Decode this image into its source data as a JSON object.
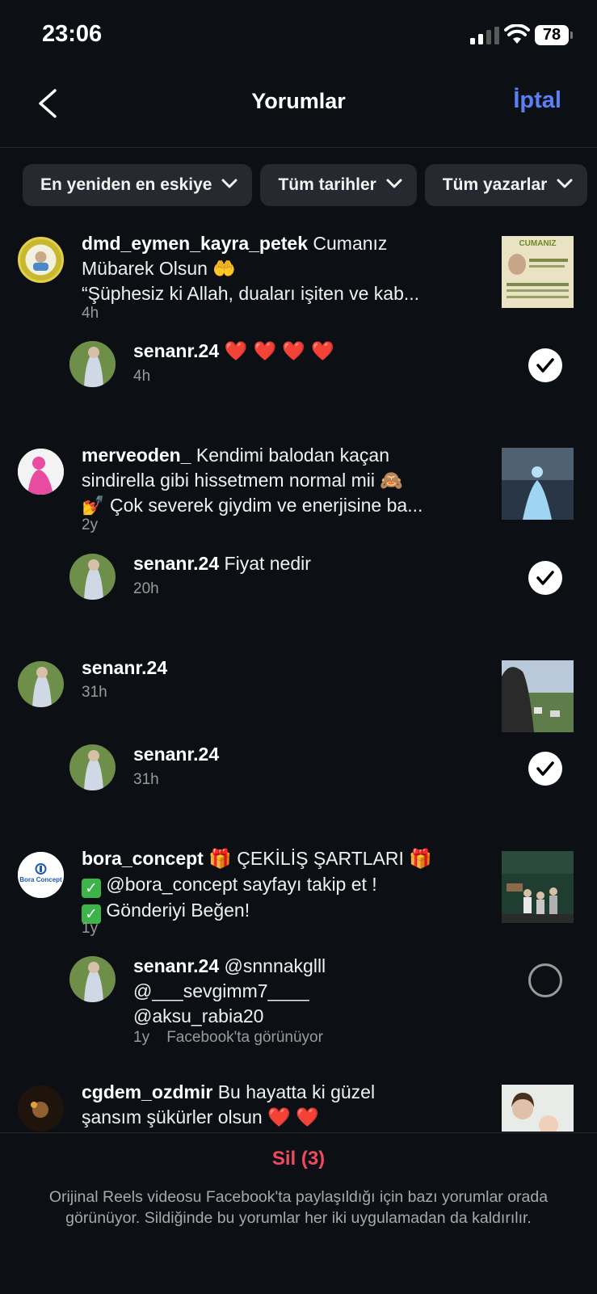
{
  "status": {
    "time": "23:06",
    "battery": "78"
  },
  "header": {
    "title": "Yorumlar",
    "cancel_label": "İptal"
  },
  "filters": [
    "En yeniden en eskiye",
    "Tüm tarihler",
    "Tüm yazarlar"
  ],
  "comments": [
    {
      "post": {
        "username": "dmd_eymen_kayra_petek",
        "text_line1": " Cumanız",
        "text_line2": "Mübarek Olsun 🤲",
        "text_line3": "“Şüphesiz ki Allah, duaları işiten ve kab...",
        "time": "4h",
        "thumb_text": "CUMANIZ"
      },
      "reply": {
        "username": "senanr.24",
        "text": "❤️ ❤️ ❤️ ❤️",
        "time": "4h",
        "selected": true
      }
    },
    {
      "post": {
        "username": "merveoden_",
        "text_line1": " Kendimi balodan kaçan",
        "text_line2": "sindirella gibi hissetmem normal mii 🙈",
        "text_line3": "💅 Çok severek giydim ve enerjisine ba...",
        "time": "2y"
      },
      "reply": {
        "username": "senanr.24",
        "text": " Fiyat nedir",
        "time": "20h",
        "selected": true
      }
    },
    {
      "post": {
        "username": "senanr.24",
        "time": "31h"
      },
      "reply": {
        "username": "senanr.24",
        "time": "31h",
        "selected": true
      }
    },
    {
      "post": {
        "username": "bora_concept",
        "text_line1": " ÇEKİLİŞ ŞARTLARI ",
        "text_line2": " @bora_concept sayfayı takip et !",
        "text_line3": " Gönderiyi Beğen!",
        "time": "1y",
        "avatar_text": "Bora Concept"
      },
      "reply": {
        "username": "senanr.24",
        "text_line1": " @snnnakglll",
        "text_line2": "@___sevgimm7____",
        "text_line3": "@aksu_rabia20",
        "time": "1y",
        "note": "Facebook'ta görünüyor",
        "selected": false
      }
    },
    {
      "post": {
        "username": "cgdem_ozdmir",
        "text_line1": " Bu hayatta ki  güzel",
        "text_line2": "şansım şükürler olsun ❤️ ❤️"
      }
    }
  ],
  "footer": {
    "delete_label": "Sil (3)",
    "note": "Orijinal Reels videosu Facebook'ta paylaşıldığı için bazı yorumlar orada görünüyor. Sildiğinde bu yorumlar her iki uygulamadan da kaldırılır."
  },
  "colors": {
    "accent": "#5b80f6",
    "delete": "#ef4a5e",
    "background": "#0c1014"
  }
}
